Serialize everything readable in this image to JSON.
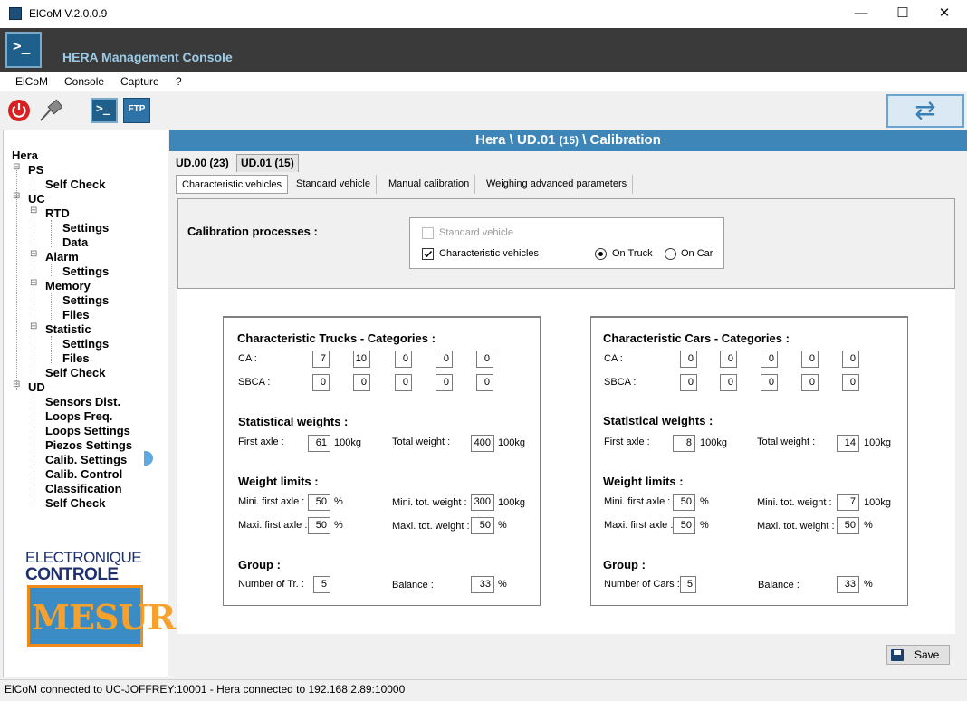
{
  "window": {
    "title": "ElCoM V.2.0.0.9",
    "minimize": "—",
    "maximize": "☐",
    "close": "✕"
  },
  "banner": {
    "title": "HERA Management Console"
  },
  "menu": [
    "ElCoM",
    "Console",
    "Capture",
    "?"
  ],
  "toolbar": {
    "ftp_label": "FTP",
    "console_label": ">_"
  },
  "tree": {
    "root": "Hera",
    "ps": "PS",
    "ps_selfcheck": "Self Check",
    "uc": "UC",
    "rtd": "RTD",
    "rtd_settings": "Settings",
    "rtd_data": "Data",
    "alarm": "Alarm",
    "alarm_settings": "Settings",
    "memory": "Memory",
    "memory_settings": "Settings",
    "memory_files": "Files",
    "statistic": "Statistic",
    "statistic_settings": "Settings",
    "statistic_files": "Files",
    "uc_selfcheck": "Self Check",
    "ud": "UD",
    "sensors": "Sensors Dist.",
    "loops_freq": "Loops Freq.",
    "loops_settings": "Loops Settings",
    "piezos": "Piezos Settings",
    "calib_settings": "Calib. Settings",
    "calib_control": "Calib. Control",
    "classification": "Classification",
    "ud_selfcheck": "Self Check"
  },
  "logo": {
    "line1": "ELECTRONIQUE",
    "line2": "CONTROLE",
    "line3": "MESURE"
  },
  "header": {
    "prefix": "Hera \\ UD.01",
    "count": "(15)",
    "suffix": "\\ Calibration"
  },
  "outer_tabs": [
    "UD.00 (23)",
    "UD.01 (15)"
  ],
  "inner_tabs": [
    "Characteristic vehicles",
    "Standard vehicle",
    "Manual calibration",
    "Weighing advanced parameters"
  ],
  "processes": {
    "label": "Calibration processes :",
    "standard_vehicle": "Standard vehicle",
    "characteristic_vehicles": "Characteristic vehicles",
    "on_truck": "On Truck",
    "on_car": "On Car"
  },
  "trucks": {
    "title": "Characteristic Trucks - Categories :",
    "ca_label": "CA :",
    "sbca_label": "SBCA :",
    "ca": [
      "7",
      "10",
      "0",
      "0",
      "0"
    ],
    "sbca": [
      "0",
      "0",
      "0",
      "0",
      "0"
    ],
    "stat_title": "Statistical weights :",
    "first_axle_label": "First axle :",
    "first_axle": "61",
    "first_axle_unit": "100kg",
    "total_weight_label": "Total weight :",
    "total_weight": "400",
    "total_weight_unit": "100kg",
    "limits_title": "Weight limits :",
    "mini_first_label": "Mini. first axle :",
    "mini_first": "50",
    "mini_first_unit": "%",
    "maxi_first_label": "Maxi. first axle :",
    "maxi_first": "50",
    "maxi_first_unit": "%",
    "mini_tot_label": "Mini. tot. weight :",
    "mini_tot": "300",
    "mini_tot_unit": "100kg",
    "maxi_tot_label": "Maxi. tot. weight :",
    "maxi_tot": "50",
    "maxi_tot_unit": "%",
    "group_title": "Group :",
    "number_label": "Number of Tr. :",
    "number": "5",
    "balance_label": "Balance :",
    "balance": "33",
    "balance_unit": "%"
  },
  "cars": {
    "title": "Characteristic Cars - Categories :",
    "ca_label": "CA :",
    "sbca_label": "SBCA :",
    "ca": [
      "0",
      "0",
      "0",
      "0",
      "0"
    ],
    "sbca": [
      "0",
      "0",
      "0",
      "0",
      "0"
    ],
    "stat_title": "Statistical weights :",
    "first_axle_label": "First axle :",
    "first_axle": "8",
    "first_axle_unit": "100kg",
    "total_weight_label": "Total weight :",
    "total_weight": "14",
    "total_weight_unit": "100kg",
    "limits_title": "Weight limits :",
    "mini_first_label": "Mini. first axle :",
    "mini_first": "50",
    "mini_first_unit": "%",
    "maxi_first_label": "Maxi. first axle :",
    "maxi_first": "50",
    "maxi_first_unit": "%",
    "mini_tot_label": "Mini. tot. weight :",
    "mini_tot": "7",
    "mini_tot_unit": "100kg",
    "maxi_tot_label": "Maxi. tot. weight :",
    "maxi_tot": "50",
    "maxi_tot_unit": "%",
    "group_title": "Group :",
    "number_label": "Number of Cars :",
    "number": "5",
    "balance_label": "Balance :",
    "balance": "33",
    "balance_unit": "%"
  },
  "save_label": "Save",
  "status": "ElCoM connected to UC-JOFFREY:10001  -  Hera connected to 192.168.2.89:10000"
}
